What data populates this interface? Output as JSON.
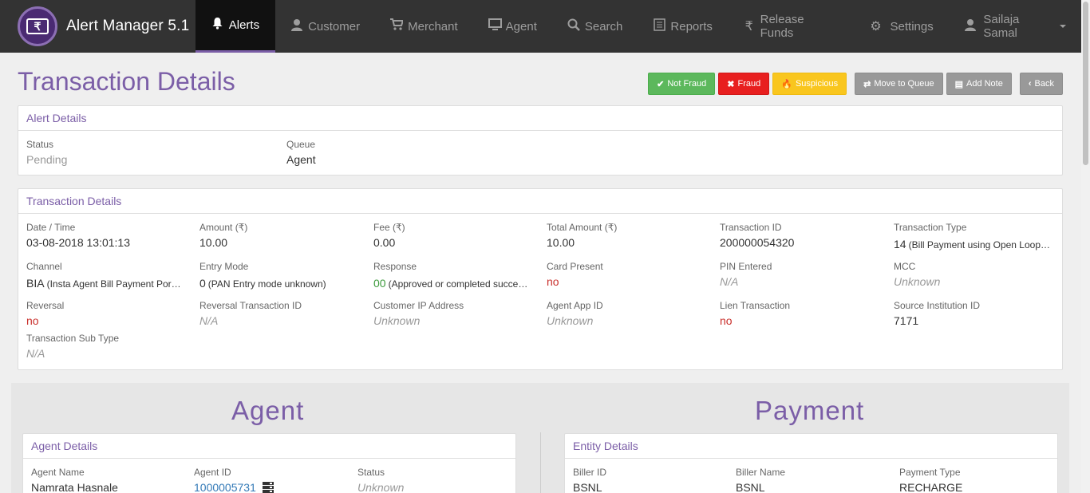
{
  "brand": {
    "title": "Alert Manager 5.1",
    "logo_symbol": "₹"
  },
  "nav": {
    "items": [
      {
        "label": "Alerts",
        "icon": "bell-icon",
        "active": true
      },
      {
        "label": "Customer",
        "icon": "user-icon"
      },
      {
        "label": "Merchant",
        "icon": "cart-icon"
      },
      {
        "label": "Agent",
        "icon": "monitor-icon"
      },
      {
        "label": "Search",
        "icon": "search-icon"
      },
      {
        "label": "Reports",
        "icon": "list-icon"
      },
      {
        "label": "Release Funds",
        "icon": "rupee-icon"
      },
      {
        "label": "Settings",
        "icon": "gear-icon"
      }
    ],
    "user": {
      "label": "Sailaja Samal",
      "icon": "user-icon"
    }
  },
  "page": {
    "title": "Transaction Details"
  },
  "actions": {
    "not_fraud": "Not Fraud",
    "fraud": "Fraud",
    "suspicious": "Suspicious",
    "move_to_queue": "Move to Queue",
    "add_note": "Add Note",
    "back": "Back"
  },
  "alert_details": {
    "heading": "Alert Details",
    "status_label": "Status",
    "status_value": "Pending",
    "queue_label": "Queue",
    "queue_value": "Agent"
  },
  "transaction": {
    "heading": "Transaction Details",
    "date_label": "Date / Time",
    "date_value": "03-08-2018 13:01:13",
    "amount_label": "Amount (₹)",
    "amount_value": "10.00",
    "fee_label": "Fee (₹)",
    "fee_value": "0.00",
    "total_label": "Total Amount (₹)",
    "total_value": "10.00",
    "txn_id_label": "Transaction ID",
    "txn_id_value": "200000054320",
    "txn_type_label": "Transaction Type",
    "txn_type_code": "14",
    "txn_type_desc": "(Bill Payment using Open Loop…",
    "channel_label": "Channel",
    "channel_code": "BIA",
    "channel_desc": "(Insta Agent Bill Payment Por…",
    "entry_label": "Entry Mode",
    "entry_code": "0",
    "entry_desc": "(PAN Entry mode unknown)",
    "response_label": "Response",
    "response_code": "00",
    "response_desc": "(Approved or completed succe…",
    "card_present_label": "Card Present",
    "card_present_value": "no",
    "pin_label": "PIN Entered",
    "pin_value": "N/A",
    "mcc_label": "MCC",
    "mcc_value": "Unknown",
    "reversal_label": "Reversal",
    "reversal_value": "no",
    "rev_id_label": "Reversal Transaction ID",
    "rev_id_value": "N/A",
    "ip_label": "Customer IP Address",
    "ip_value": "Unknown",
    "app_id_label": "Agent App ID",
    "app_id_value": "Unknown",
    "lien_label": "Lien Transaction",
    "lien_value": "no",
    "source_label": "Source Institution ID",
    "source_value": "7171",
    "subtype_label": "Transaction Sub Type",
    "subtype_value": "N/A"
  },
  "agent_section": {
    "title": "Agent",
    "panel_heading": "Agent Details",
    "name_label": "Agent Name",
    "name_value": "Namrata Hasnale",
    "id_label": "Agent ID",
    "id_value": "1000005731",
    "status_label": "Status",
    "status_value": "Unknown"
  },
  "payment_section": {
    "title": "Payment",
    "panel_heading": "Entity Details",
    "biller_id_label": "Biller ID",
    "biller_id_value": "BSNL",
    "biller_name_label": "Biller Name",
    "biller_name_value": "BSNL",
    "payment_type_label": "Payment Type",
    "payment_type_value": "RECHARGE"
  },
  "colors": {
    "accent": "#7b5ea7",
    "navbar": "#333333",
    "green": "#5cb85c",
    "red": "#e81f1f",
    "yellow": "#f9c61e",
    "gray": "#999999"
  }
}
